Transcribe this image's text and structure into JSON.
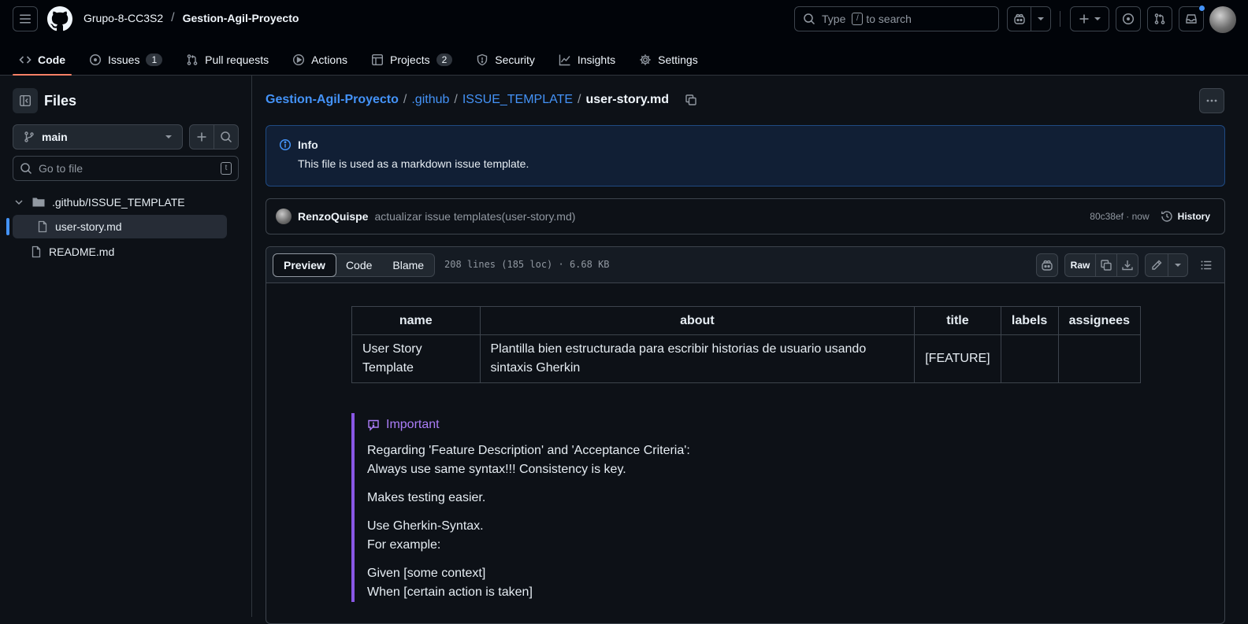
{
  "header": {
    "owner": "Grupo-8-CC3S2",
    "separator": "/",
    "repo": "Gestion-Agil-Proyecto",
    "search": {
      "placeholder_before": "Type",
      "placeholder_key": "/",
      "placeholder_after": "to search"
    }
  },
  "tabs": [
    {
      "label": "Code",
      "icon": "code-icon",
      "active": true
    },
    {
      "label": "Issues",
      "icon": "issue-opened-icon",
      "count": "1"
    },
    {
      "label": "Pull requests",
      "icon": "git-pull-request-icon"
    },
    {
      "label": "Actions",
      "icon": "play-icon"
    },
    {
      "label": "Projects",
      "icon": "table-icon",
      "count": "2"
    },
    {
      "label": "Security",
      "icon": "shield-icon"
    },
    {
      "label": "Insights",
      "icon": "graph-icon"
    },
    {
      "label": "Settings",
      "icon": "gear-icon"
    }
  ],
  "sidebar": {
    "title": "Files",
    "branch": "main",
    "goto_placeholder": "Go to file",
    "goto_key": "t",
    "tree": {
      "folder": ".github/ISSUE_TEMPLATE",
      "folder_file": "user-story.md",
      "root_file": "README.md"
    }
  },
  "path": {
    "repo": "Gestion-Agil-Proyecto",
    "dir1": ".github",
    "dir2": "ISSUE_TEMPLATE",
    "file": "user-story.md",
    "sep": "/"
  },
  "info": {
    "title": "Info",
    "text": "This file is used as a markdown issue template."
  },
  "commit": {
    "author": "RenzoQuispe",
    "message": "actualizar issue templates(user-story.md)",
    "meta": "80c38ef · now",
    "history_label": "History"
  },
  "file_header": {
    "tabs": [
      "Preview",
      "Code",
      "Blame"
    ],
    "active_tab": "Preview",
    "meta": "208 lines (185 loc) · 6.68 KB",
    "raw_label": "Raw"
  },
  "frontmatter_table": {
    "headers": [
      "name",
      "about",
      "title",
      "labels",
      "assignees"
    ],
    "row": [
      "User Story Template",
      "Plantilla bien estructurada para escribir historias de usuario usando sintaxis Gherkin",
      "[FEATURE]",
      "",
      ""
    ]
  },
  "important": {
    "title": "Important",
    "p1_line1": "Regarding 'Feature Description' and 'Acceptance Criteria':",
    "p1_line2": "Always use same syntax!!! Consistency is key.",
    "p2": "Makes testing easier.",
    "p3_line1": "Use Gherkin-Syntax.",
    "p3_line2": "For example:",
    "p4_line1": "Given [some context]",
    "p4_line2": "When [certain action is taken]"
  },
  "colors": {
    "accent_tab": "#f78166",
    "link": "#4493f8",
    "important": "#ab7df8"
  }
}
